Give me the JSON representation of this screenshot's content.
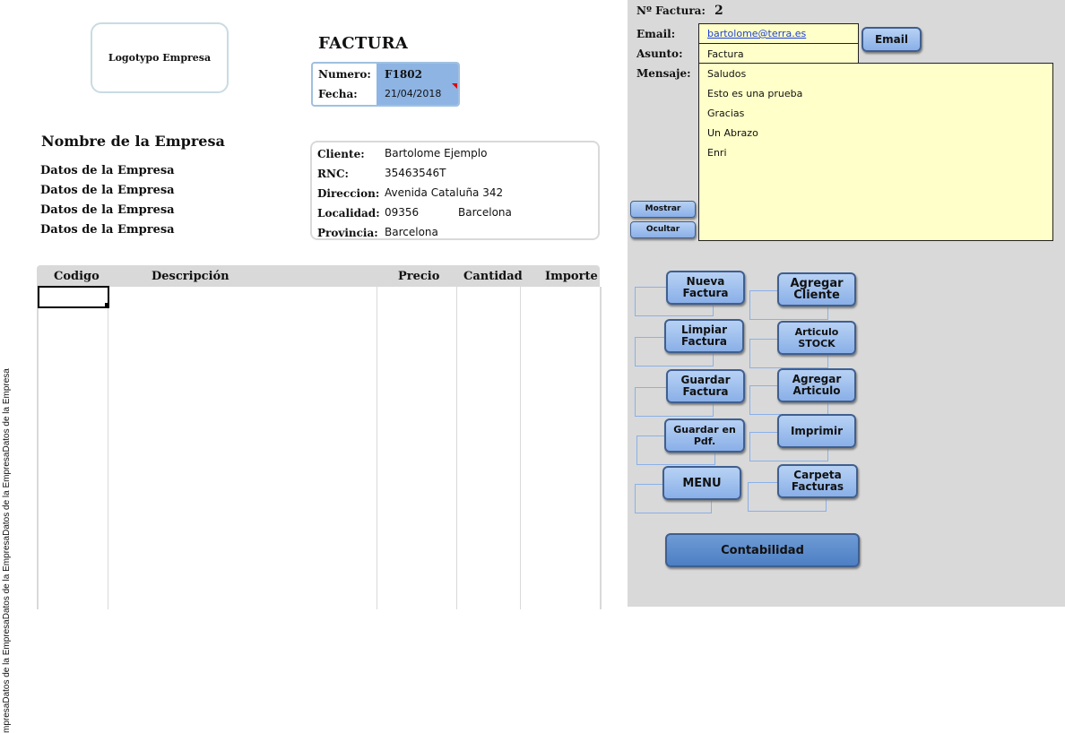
{
  "left_vertical_text": "mpresaDatos de la EmpresaDatos de la EmpresaDatos de la EmpresaDatos de la Empresa",
  "logo": "Logotypo Empresa",
  "invoice": {
    "title": "FACTURA",
    "numero_label": "Numero:",
    "numero_value": "F1802",
    "fecha_label": "Fecha:",
    "fecha_value": "21/04/2018"
  },
  "company": {
    "name": "Nombre de la Empresa",
    "lines": [
      "Datos de la Empresa",
      "Datos de la Empresa",
      "Datos de la Empresa",
      "Datos de la Empresa"
    ]
  },
  "client": {
    "cliente_label": "Cliente:",
    "cliente_value": "Bartolome Ejemplo",
    "rnc_label": "RNC:",
    "rnc_value": "35463546T",
    "direccion_label": "Direccion:",
    "direccion_value": "Avenida Cataluña 342",
    "localidad_label": "Localidad:",
    "localidad_cp": "09356",
    "localidad_city": "Barcelona",
    "provincia_label": "Provincia:",
    "provincia_value": "Barcelona"
  },
  "table": {
    "headers": [
      "Codigo",
      "Descripción",
      "Precio",
      "Cantidad",
      "Importe"
    ]
  },
  "panel": {
    "nfactura_label": "Nº Factura:",
    "nfactura_value": "2",
    "email_label": "Email:",
    "email_value": "bartolome@terra.es",
    "asunto_label": "Asunto:",
    "asunto_value": "Factura",
    "mensaje_label": "Mensaje:",
    "mensaje_lines": [
      "Saludos",
      "Esto es una prueba",
      "Gracias",
      "Un Abrazo",
      "Enri"
    ],
    "email_button": "Email",
    "mostrar_button": "Mostrar",
    "ocultar_button": "Ocultar"
  },
  "buttons": {
    "nueva_factura": "Nueva Factura",
    "agregar_cliente": "Agregar Cliente",
    "limpiar_factura": "Limpiar Factura",
    "articulo_stock": "Articulo STOCK",
    "guardar_factura": "Guardar Factura",
    "agregar_articulo": "Agregar Articulo",
    "guardar_pdf": "Guardar en Pdf.",
    "imprimir": "Imprimir",
    "menu": "MENU",
    "carpeta_facturas": "Carpeta Facturas",
    "contabilidad": "Contabilidad"
  },
  "colors": {
    "panel_bg": "#d9d9d9",
    "yellow_field": "#ffffc9",
    "button_blue": "#8ab0e8",
    "header_blue": "#8eb4e3"
  }
}
